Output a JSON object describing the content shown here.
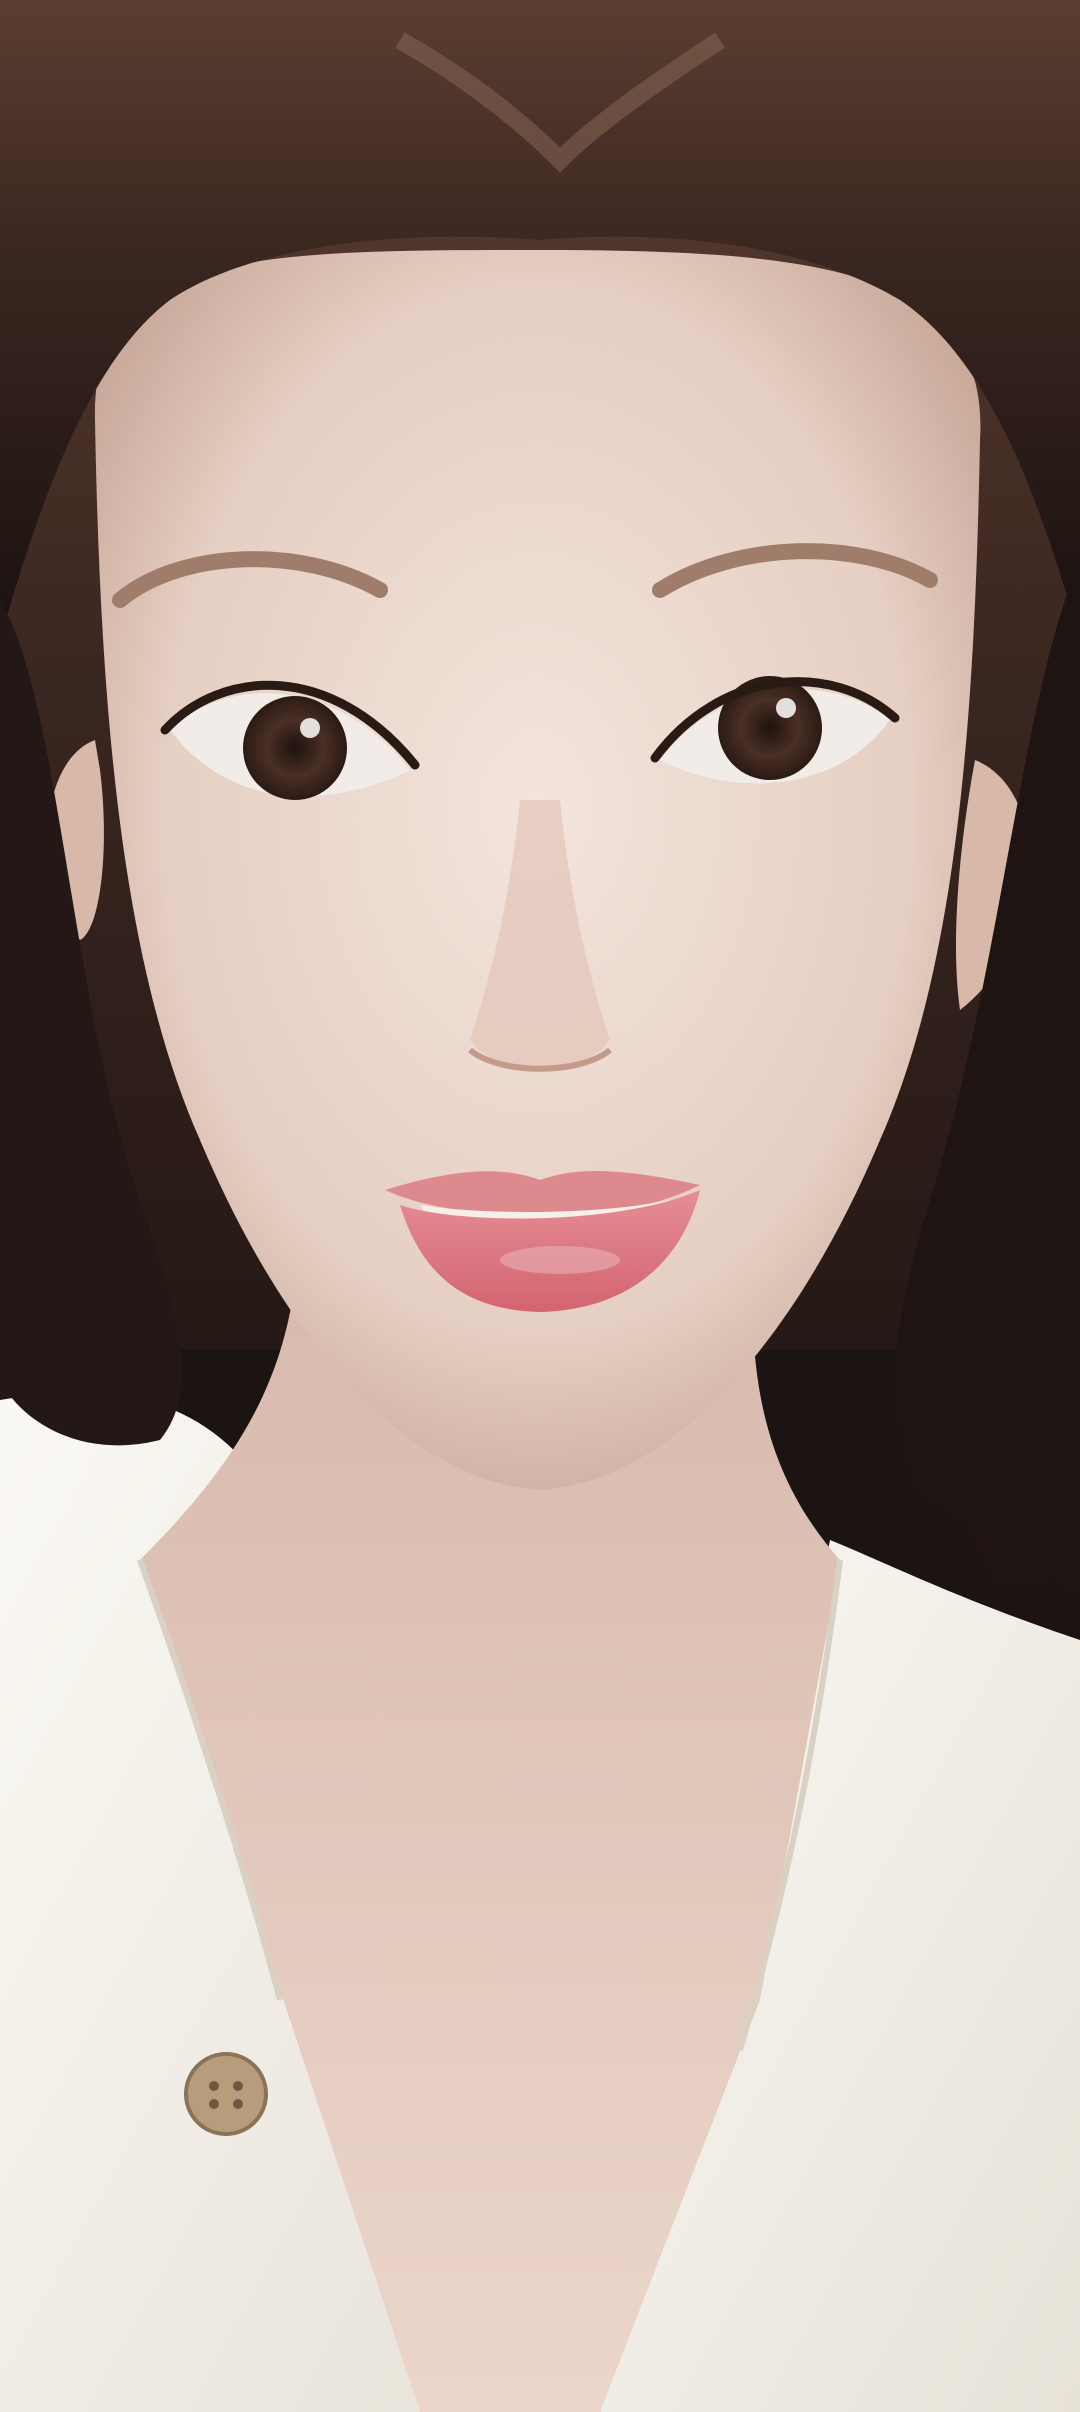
{
  "photo": {
    "subject": "portrait",
    "palette": {
      "hair": "#2a1d19",
      "hair_highlight": "#6b4a3a",
      "skin": "#ecd9cf",
      "skin_shadow": "#c9a99a",
      "lips": "#e07a86",
      "iris": "#4a2f25",
      "shirt": "#f4f1ea",
      "button": "#b89d7c",
      "background": "#1c1412"
    }
  }
}
